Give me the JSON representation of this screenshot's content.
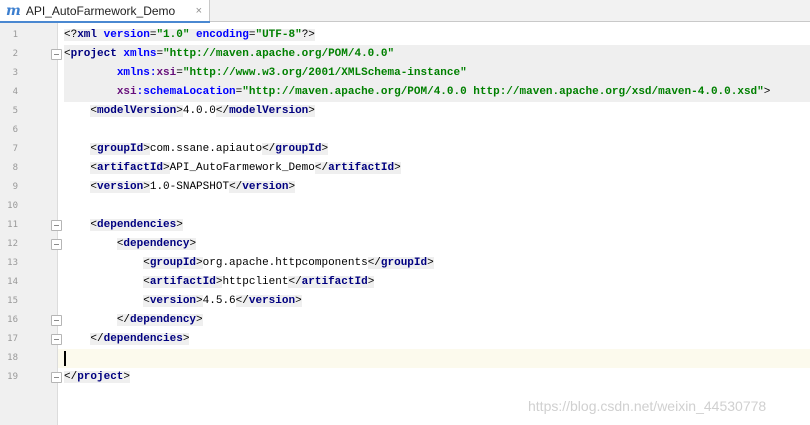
{
  "tab": {
    "icon": "m",
    "title": "API_AutoFarmework_Demo",
    "close": "×"
  },
  "editor": {
    "line_numbers": [
      "1",
      "2",
      "3",
      "4",
      "5",
      "6",
      "7",
      "8",
      "9",
      "10",
      "11",
      "12",
      "13",
      "14",
      "15",
      "16",
      "17",
      "18",
      "19"
    ],
    "lines": {
      "l1": {
        "open": "<?",
        "tag": "xml",
        "attr1": " version",
        "eq1": "=",
        "val1": "\"1.0\"",
        "attr2": " encoding",
        "eq2": "=",
        "val2": "\"UTF-8\"",
        "close": "?>"
      },
      "l2": {
        "open": "<",
        "tag": "project",
        "attr": " xmlns",
        "eq": "=",
        "val": "\"http://maven.apache.org/POM/4.0.0\""
      },
      "l3": {
        "indent": "        ",
        "attr": "xmlns",
        "colon": ":",
        "ns": "xsi",
        "eq": "=",
        "val": "\"http://www.w3.org/2001/XMLSchema-instance\""
      },
      "l4": {
        "indent": "        ",
        "ns": "xsi",
        "colon": ":",
        "attr": "schemaLocation",
        "eq": "=",
        "val": "\"http://maven.apache.org/POM/4.0.0 http://maven.apache.org/xsd/maven-4.0.0.xsd\"",
        "close": ">"
      },
      "l5": {
        "indent": "    ",
        "tag": "modelVersion",
        "text": "4.0.0"
      },
      "l7": {
        "indent": "    ",
        "tag": "groupId",
        "text": "com.ssane.apiauto"
      },
      "l8": {
        "indent": "    ",
        "tag": "artifactId",
        "text": "API_AutoFarmework_Demo"
      },
      "l9": {
        "indent": "    ",
        "tag": "version",
        "text": "1.0-SNAPSHOT"
      },
      "l11": {
        "indent": "    ",
        "tag": "dependencies"
      },
      "l12": {
        "indent": "        ",
        "tag": "dependency"
      },
      "l13": {
        "indent": "            ",
        "tag": "groupId",
        "text": "org.apache.httpcomponents"
      },
      "l14": {
        "indent": "            ",
        "tag": "artifactId",
        "text": "httpclient"
      },
      "l15": {
        "indent": "            ",
        "tag": "version",
        "text": "4.5.6"
      },
      "l16": {
        "indent": "        ",
        "tag": "dependency"
      },
      "l17": {
        "indent": "    ",
        "tag": "dependencies"
      },
      "l19": {
        "tag": "project"
      }
    }
  },
  "watermark": "https://blog.csdn.net/weixin_44530778",
  "colors": {
    "tag": "#000080",
    "attribute": "#0000ff",
    "value": "#008000",
    "namespace": "#660e7a",
    "current_line": "#fcfaed"
  }
}
